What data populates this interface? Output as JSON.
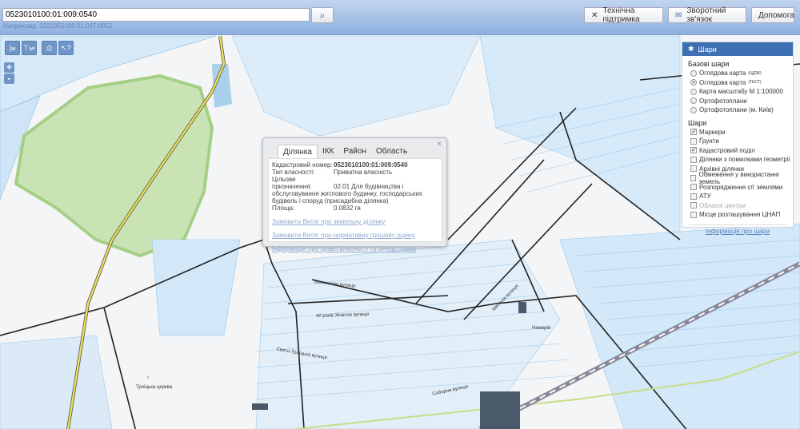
{
  "header": {
    "search_value": "0523010100:01:009:0540",
    "search_hint": "Наприклад: 3221855100:01:047:0052",
    "support": "Технічна підтримка",
    "feedback": "Зворотний зв'язок",
    "help": "Допомога"
  },
  "toolbar": {
    "ruler": "м",
    "area": "м²",
    "zoom_in": "+",
    "zoom_out": "-"
  },
  "popup": {
    "tabs": [
      "Ділянка",
      "ІКК",
      "Район",
      "Область"
    ],
    "close": "×",
    "fields": [
      {
        "k": "Кадастровий номер:",
        "v": "0523010100:01:009:0540"
      },
      {
        "k": "Тип власності:",
        "v": "Приватна власність"
      },
      {
        "k": "Цільове призначення:",
        "v": "02.01 Для будівництва і обслуговування житлового будинку, господарських будівель і споруд (присадибна ділянка)"
      },
      {
        "k": "Площа:",
        "v": "0.0832 га"
      }
    ],
    "links": [
      "Замовити Витяг про земельну ділянку",
      "Замовити Витяг про нормативну грошову оцінку",
      "Інформація про право власності та речові права"
    ]
  },
  "layers": {
    "title": "Шари",
    "base_title": "Базові шари",
    "base": [
      {
        "label": "Оглядова карта",
        "sup": "(ЦДЗК)",
        "on": false
      },
      {
        "label": "Оглядова карта",
        "sup": "(ТЕСТ)",
        "on": true
      },
      {
        "label": "Карта масштабу М 1:100000",
        "sup": "",
        "on": false
      },
      {
        "label": "Ортофотоплани",
        "sup": "",
        "on": false
      },
      {
        "label": "Ортофотоплани (м. Київ)",
        "sup": "",
        "on": false
      }
    ],
    "layers_title": "Шари",
    "items": [
      {
        "label": "Маркери",
        "on": true
      },
      {
        "label": "Ґрунти",
        "on": false
      },
      {
        "label": "Кадастровий поділ",
        "on": true
      },
      {
        "label": "Ділянки з помилками геометрії",
        "on": false
      },
      {
        "label": "Архівні ділянки",
        "on": false
      },
      {
        "label": "Обмеження у використанні земель",
        "on": false
      },
      {
        "label": "Розпорядження с/г землями",
        "on": false
      },
      {
        "label": "АТУ",
        "on": false
      },
      {
        "label": "Обласні центри",
        "on": false,
        "disabled": true
      },
      {
        "label": "Місце розташування ЦНАП",
        "on": false
      }
    ],
    "info_link": "Інформація про шари"
  },
  "map": {
    "church": "Троїцька церква",
    "station": "Немирів",
    "streets": [
      "Больнична вулиця",
      "40 років Жовтня вулиця",
      "Свято-Троїцька вулиця",
      "Соборна вулиця",
      "Шкільна вулиця"
    ]
  },
  "colors": {
    "header": "#8eb0de",
    "layers_head": "#3f6fb3",
    "parcel": "#c9e2f7",
    "road": "#e8e060"
  }
}
